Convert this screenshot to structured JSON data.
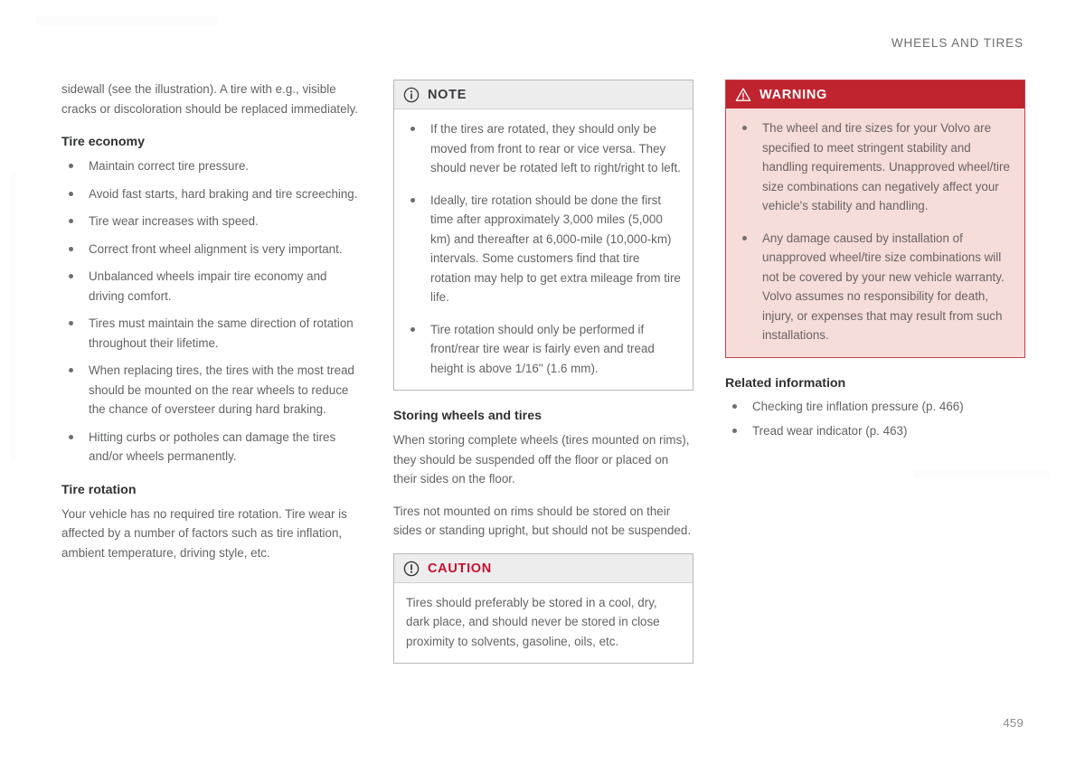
{
  "header": {
    "title": "WHEELS AND TIRES",
    "page_number": "459"
  },
  "colors": {
    "warning_red": "#c0242f",
    "caution_red": "#c8102e",
    "warning_bg": "#f6ddda",
    "box_head_bg": "#ededee",
    "body_text": "#636466"
  },
  "column1": {
    "intro": "sidewall (see the illustration). A tire with e.g., visible cracks or discoloration should be replaced immediately.",
    "tire_economy": {
      "heading": "Tire economy",
      "bullets": [
        "Maintain correct tire pressure.",
        "Avoid fast starts, hard braking and tire screeching.",
        "Tire wear increases with speed.",
        "Correct front wheel alignment is very important.",
        "Unbalanced wheels impair tire economy and driving comfort.",
        "Tires must maintain the same direction of rotation throughout their lifetime.",
        "When replacing tires, the tires with the most tread should be mounted on the rear wheels to reduce the chance of oversteer during hard braking.",
        "Hitting curbs or potholes can damage the tires and/or wheels permanently."
      ]
    },
    "tire_rotation": {
      "heading": "Tire rotation",
      "text": "Your vehicle has no required tire rotation. Tire wear is affected by a number of factors such as tire inflation, ambient temperature, driving style, etc."
    }
  },
  "column2": {
    "note_box": {
      "icon": "info-circle-icon",
      "title": "NOTE",
      "bullets": [
        "If the tires are rotated, they should only be moved from front to rear or vice versa. They should never be rotated left to right/right to left.",
        "Ideally, tire rotation should be done the first time after approximately 3,000 miles (5,000 km) and thereafter at 6,000-mile (10,000-km) intervals. Some customers find that tire rotation may help to get extra mileage from tire life.",
        "Tire rotation should only be performed if front/rear tire wear is fairly even and tread height is above 1/16\" (1.6 mm)."
      ]
    },
    "storing": {
      "heading": "Storing wheels and tires",
      "paragraphs": [
        "When storing complete wheels (tires mounted on rims), they should be suspended off the floor or placed on their sides on the floor.",
        "Tires not mounted on rims should be stored on their sides or standing upright, but should not be suspended."
      ]
    },
    "caution_box": {
      "icon": "exclamation-circle-icon",
      "title": "CAUTION",
      "text": "Tires should preferably be stored in a cool, dry, dark place, and should never be stored in close proximity to solvents, gasoline, oils, etc."
    }
  },
  "column3": {
    "warning_box": {
      "icon": "warning-triangle-icon",
      "title": "WARNING",
      "bullets": [
        "The wheel and tire sizes for your Volvo are specified to meet stringent stability and handling requirements. Unapproved wheel/tire size combinations can negatively affect your vehicle's stability and handling.",
        "Any damage caused by installation of unapproved wheel/tire size combinations will not be covered by your new vehicle warranty. Volvo assumes no responsibility for death, injury, or expenses that may result from such installations."
      ]
    },
    "related": {
      "heading": "Related information",
      "links": [
        "Checking tire inflation pressure (p. 466)",
        "Tread wear indicator (p. 463)"
      ]
    }
  }
}
